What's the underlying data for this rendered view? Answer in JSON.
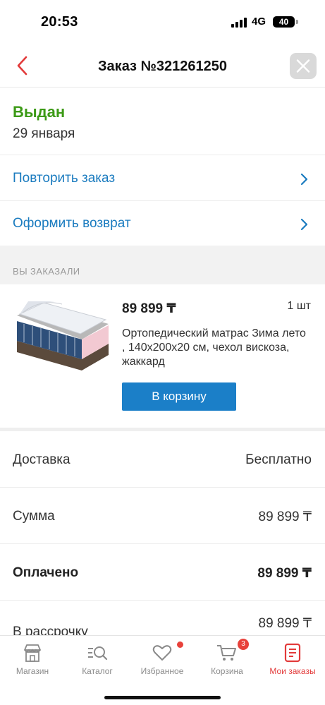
{
  "status_bar": {
    "time": "20:53",
    "network": "4G",
    "battery": "40"
  },
  "header": {
    "title": "Заказ №321261250"
  },
  "order_status": {
    "label": "Выдан",
    "date": "29 января"
  },
  "actions": [
    {
      "label": "Повторить заказ"
    },
    {
      "label": "Оформить возврат"
    }
  ],
  "items_section": {
    "title": "ВЫ ЗАКАЗАЛИ"
  },
  "item": {
    "price": "89 899 ₸",
    "quantity": "1 шт",
    "name": "Ортопедический матрас Зима лето , 140x200x20 см, чехол вискоза, жаккард",
    "cart_button": "В корзину"
  },
  "summary": [
    {
      "label": "Доставка",
      "value": "Бесплатно"
    },
    {
      "label": "Сумма",
      "value": "89 899 ₸"
    },
    {
      "label": "Оплачено",
      "value": "89 899 ₸"
    },
    {
      "label": "В рассрочку",
      "value": "89 899 ₸"
    }
  ],
  "tabbar": {
    "tabs": [
      {
        "label": "Магазин",
        "icon": "store-icon"
      },
      {
        "label": "Каталог",
        "icon": "catalog-search-icon"
      },
      {
        "label": "Избранное",
        "icon": "heart-icon"
      },
      {
        "label": "Корзина",
        "icon": "cart-icon",
        "badge": "3"
      },
      {
        "label": "Мои заказы",
        "icon": "orders-icon"
      }
    ],
    "active_index": 4
  },
  "colors": {
    "accent_blue": "#1b7fc8",
    "link_blue": "#1a7bbf",
    "status_green": "#3c9a16",
    "active_red": "#e23a3a"
  }
}
